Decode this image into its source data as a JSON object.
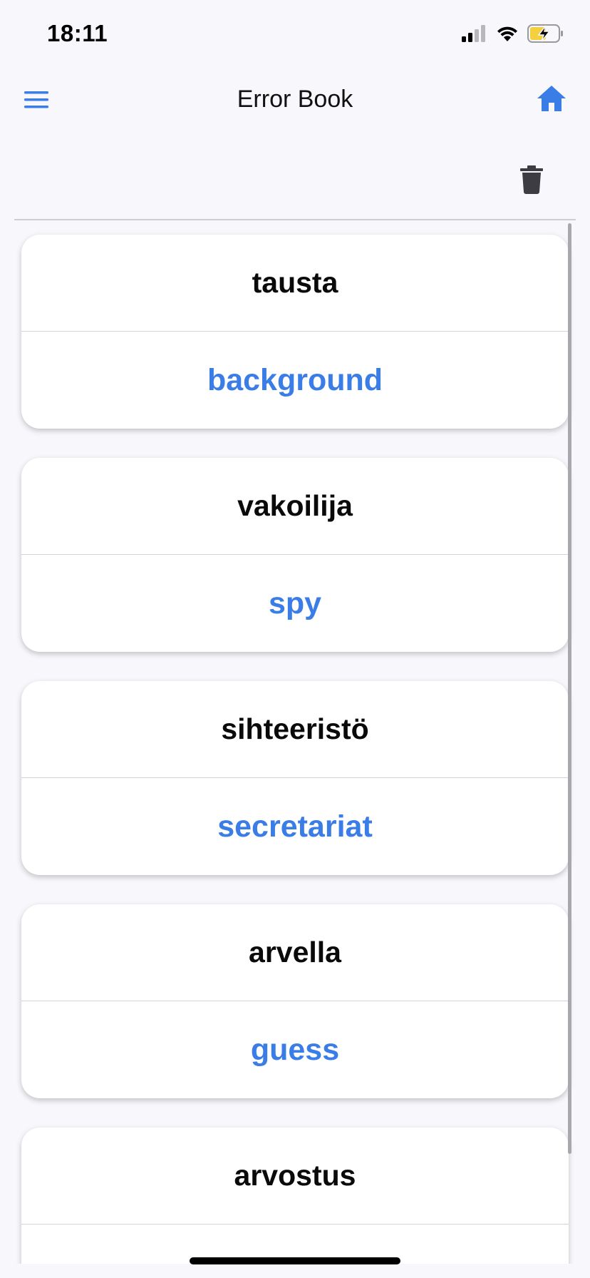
{
  "status_bar": {
    "time": "18:11",
    "icons": [
      "cellular-signal-icon",
      "wifi-icon",
      "battery-charging-icon"
    ]
  },
  "header": {
    "title": "Error Book",
    "left_icon": "hamburger-menu-icon",
    "right_icon": "home-icon"
  },
  "toolbar": {
    "delete_icon": "trash-icon"
  },
  "colors": {
    "accent": "#3a7de6",
    "background": "#f8f7fb",
    "card": "#ffffff",
    "battery_fill": "#f4d03f"
  },
  "cards": [
    {
      "term": "tausta",
      "translation": "background"
    },
    {
      "term": "vakoilija",
      "translation": "spy"
    },
    {
      "term": "sihteeristö",
      "translation": "secretariat"
    },
    {
      "term": "arvella",
      "translation": "guess"
    },
    {
      "term": "arvostus",
      "translation": ""
    }
  ]
}
